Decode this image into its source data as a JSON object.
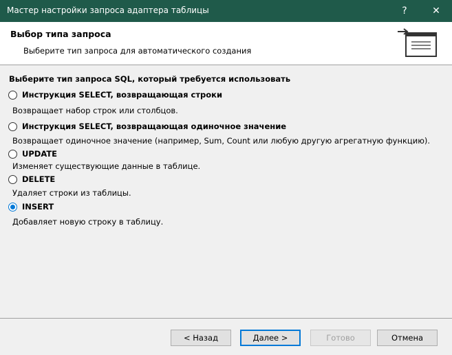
{
  "window": {
    "title": "Мастер настройки запроса адаптера таблицы"
  },
  "title_controls": {
    "help": "?",
    "close": "✕"
  },
  "header": {
    "title": "Выбор типа запроса",
    "subtitle": "Выберите тип запроса для автоматического создания",
    "icon": "wizard-table-icon"
  },
  "prompt": "Выберите тип запроса SQL, который требуется использовать",
  "options": [
    {
      "label": "Инструкция SELECT, возвращающая строки",
      "description": "Возвращает набор строк или столбцов.",
      "selected": false
    },
    {
      "label": "Инструкция SELECT, возвращающая одиночное значение",
      "description": "Возвращает одиночное значение (например, Sum, Count или любую другую агрегатную функцию).",
      "selected": false
    },
    {
      "label": "UPDATE",
      "description": "Изменяет существующие данные в таблице.",
      "selected": false
    },
    {
      "label": "DELETE",
      "description": "Удаляет строки из таблицы.",
      "selected": false
    },
    {
      "label": "INSERT",
      "description": "Добавляет новую строку в таблицу.",
      "selected": true
    }
  ],
  "buttons": {
    "back": "< Назад",
    "next": "Далее >",
    "finish": "Готово",
    "cancel": "Отмена"
  },
  "colors": {
    "titlebar": "#1f5a4a",
    "accent": "#0078d7"
  }
}
